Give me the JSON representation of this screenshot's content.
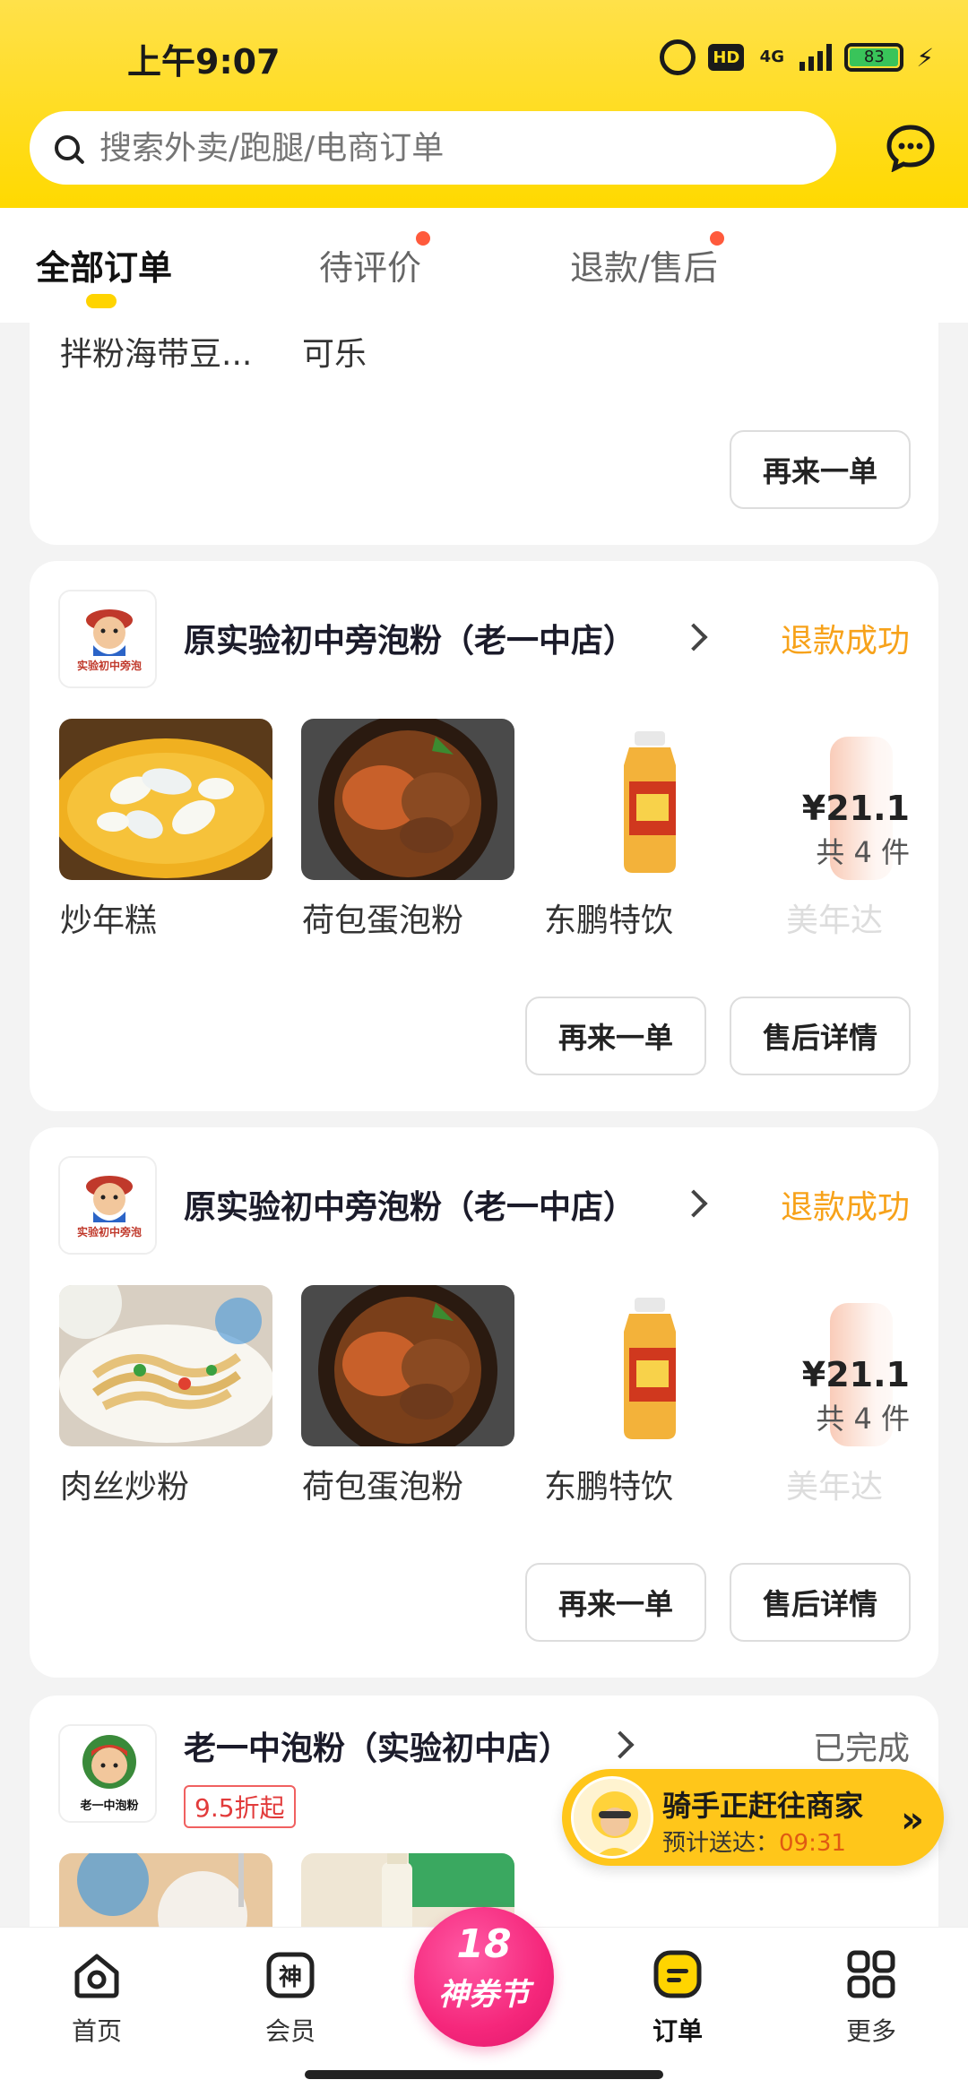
{
  "status_bar": {
    "time": "上午9:07",
    "battery": "83",
    "network": "4G",
    "hd": "HD"
  },
  "search": {
    "placeholder": "搜索外卖/跑腿/电商订单"
  },
  "tabs": [
    {
      "label": "全部订单"
    },
    {
      "label": "待评价"
    },
    {
      "label": "退款/售后"
    }
  ],
  "top_card": {
    "items": [
      "拌粉海带豆...",
      "可乐"
    ],
    "reorder_label": "再来一单"
  },
  "orders": [
    {
      "shop": "原实验初中旁泡粉（老一中店）",
      "status": "退款成功",
      "items": [
        "炒年糕",
        "荷包蛋泡粉",
        "东鹏特饮",
        "美年达"
      ],
      "price": "¥21.1",
      "count": "共 4 件",
      "reorder_label": "再来一单",
      "aftersale_label": "售后详情",
      "logo_text": "实验初中旁泡"
    },
    {
      "shop": "原实验初中旁泡粉（老一中店）",
      "status": "退款成功",
      "items": [
        "肉丝炒粉",
        "荷包蛋泡粉",
        "东鹏特饮",
        "美年达"
      ],
      "price": "¥21.1",
      "count": "共 4 件",
      "reorder_label": "再来一单",
      "aftersale_label": "售后详情",
      "logo_text": "实验初中旁泡"
    },
    {
      "shop": "老一中泡粉（实验初中店）",
      "status": "已完成",
      "discount": "9.5折起",
      "logo_text": "老一中泡粉"
    }
  ],
  "rider": {
    "title": "骑手正赶往商家",
    "eta_label": "预计送达：",
    "eta_time": "09:31"
  },
  "nav": {
    "home": "首页",
    "member": "会员",
    "promo_num": "18",
    "promo_label": "神券节",
    "orders": "订单",
    "more": "更多"
  },
  "colors": {
    "brand": "#ffd900",
    "refund": "#f7a21a",
    "promo": "#f5277b"
  }
}
